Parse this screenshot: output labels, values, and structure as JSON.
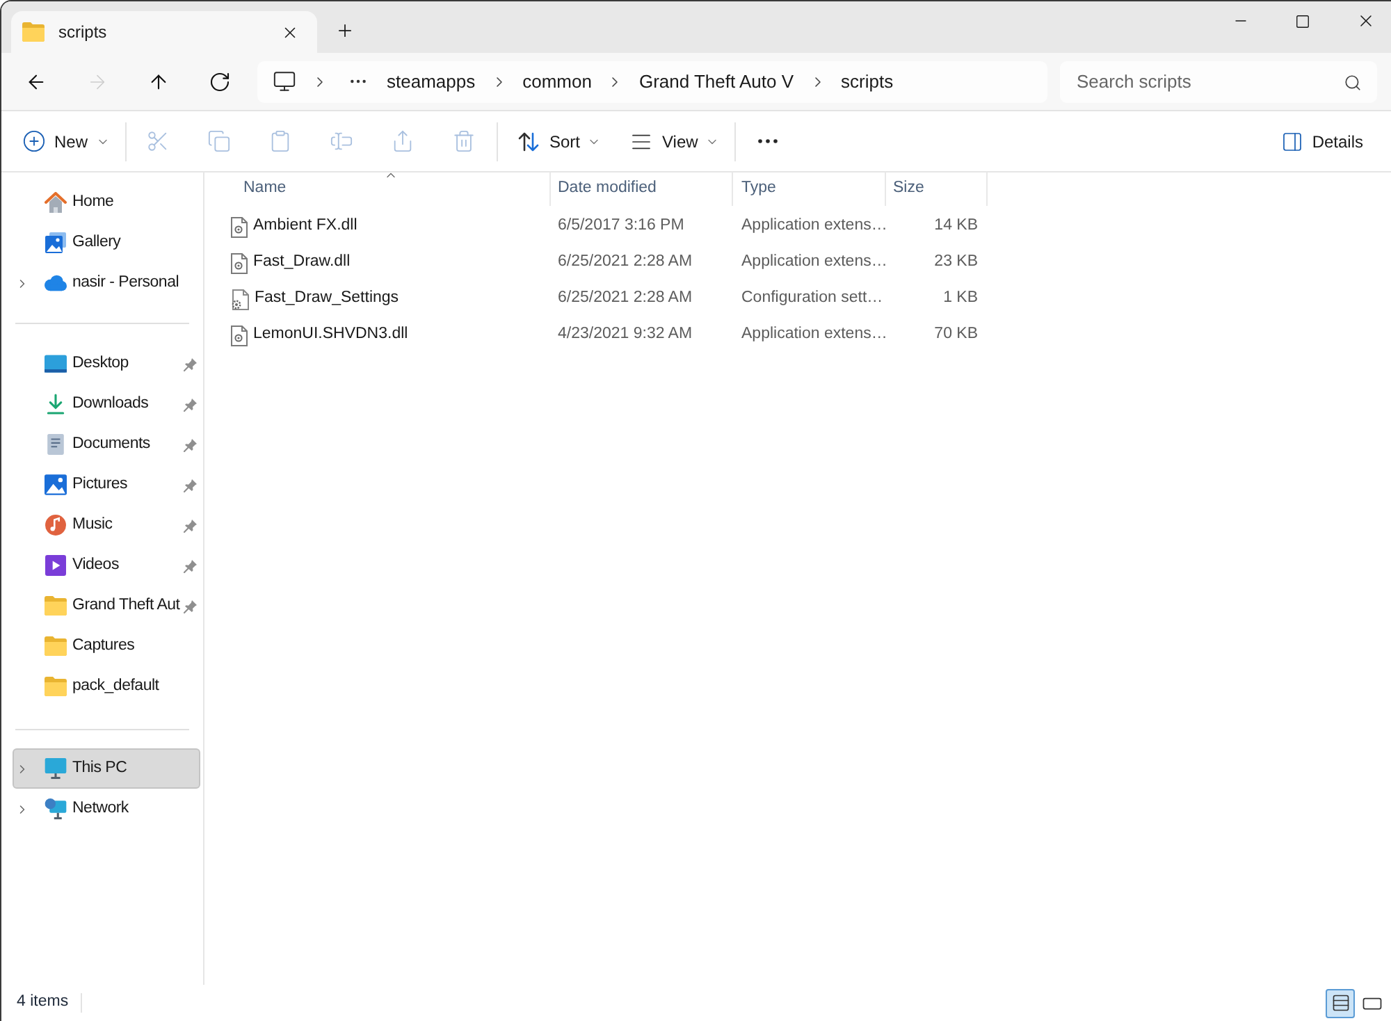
{
  "tabs": [
    {
      "title": "scripts",
      "selected": true
    }
  ],
  "nav_buttons": [
    {
      "disabled": false
    },
    {
      "disabled": true
    },
    {
      "disabled": false
    },
    {
      "disabled": false
    }
  ],
  "address_bar": {
    "breadcrumbs": [
      "steamapps",
      "common",
      "Grand Theft Auto V",
      "scripts"
    ]
  },
  "search": {
    "placeholder": "Search scripts"
  },
  "command_bar": {
    "new": "New",
    "actions": [
      {
        "disabled": true
      },
      {
        "disabled": true
      },
      {
        "disabled": true
      },
      {
        "disabled": true
      },
      {
        "disabled": true
      },
      {
        "disabled": true
      }
    ],
    "sort": "Sort",
    "view": "View",
    "details": "Details"
  },
  "sidebar": {
    "sections": [
      {
        "items": [
          {
            "label": "Home",
            "selected": false
          },
          {
            "label": "Gallery",
            "selected": false
          },
          {
            "label": "nasir - Personal",
            "selected": false,
            "expanded": false
          }
        ]
      },
      {
        "items": [
          {
            "label": "Desktop",
            "selected": false,
            "pinned": true
          },
          {
            "label": "Downloads",
            "selected": false,
            "pinned": true
          },
          {
            "label": "Documents",
            "selected": false,
            "pinned": true
          },
          {
            "label": "Pictures",
            "selected": false,
            "pinned": true
          },
          {
            "label": "Music",
            "selected": false,
            "pinned": true
          },
          {
            "label": "Videos",
            "selected": false,
            "pinned": true
          },
          {
            "label": "Grand Theft Aut",
            "selected": false,
            "pinned": true
          },
          {
            "label": "Captures",
            "selected": false,
            "pinned": false
          },
          {
            "label": "pack_default",
            "selected": false,
            "pinned": false
          }
        ]
      },
      {
        "items": [
          {
            "label": "This PC",
            "selected": true,
            "expanded": false
          },
          {
            "label": "Network",
            "selected": false,
            "expanded": false
          }
        ]
      }
    ]
  },
  "file_list": {
    "columns": [
      {
        "label": "Name",
        "sorted": true
      },
      {
        "label": "Date modified",
        "sorted": false
      },
      {
        "label": "Type",
        "sorted": false
      },
      {
        "label": "Size",
        "sorted": false
      }
    ],
    "rows": [
      {
        "kind": "extension",
        "name": "Ambient FX.dll",
        "date_modified": "6/5/2017 3:16 PM",
        "type": "Application extens…",
        "size": "14 KB"
      },
      {
        "kind": "extension",
        "name": "Fast_Draw.dll",
        "date_modified": "6/25/2021 2:28 AM",
        "type": "Application extens…",
        "size": "23 KB"
      },
      {
        "kind": "settings",
        "name": "Fast_Draw_Settings",
        "date_modified": "6/25/2021 2:28 AM",
        "type": "Configuration sett…",
        "size": "1 KB"
      },
      {
        "kind": "extension",
        "name": "LemonUI.SHVDN3.dll",
        "date_modified": "4/23/2021 9:32 AM",
        "type": "Application extens…",
        "size": "70 KB"
      }
    ]
  },
  "status_bar": {
    "item_count": "4 items",
    "views": [
      {
        "selected": true
      },
      {
        "selected": false
      }
    ]
  }
}
